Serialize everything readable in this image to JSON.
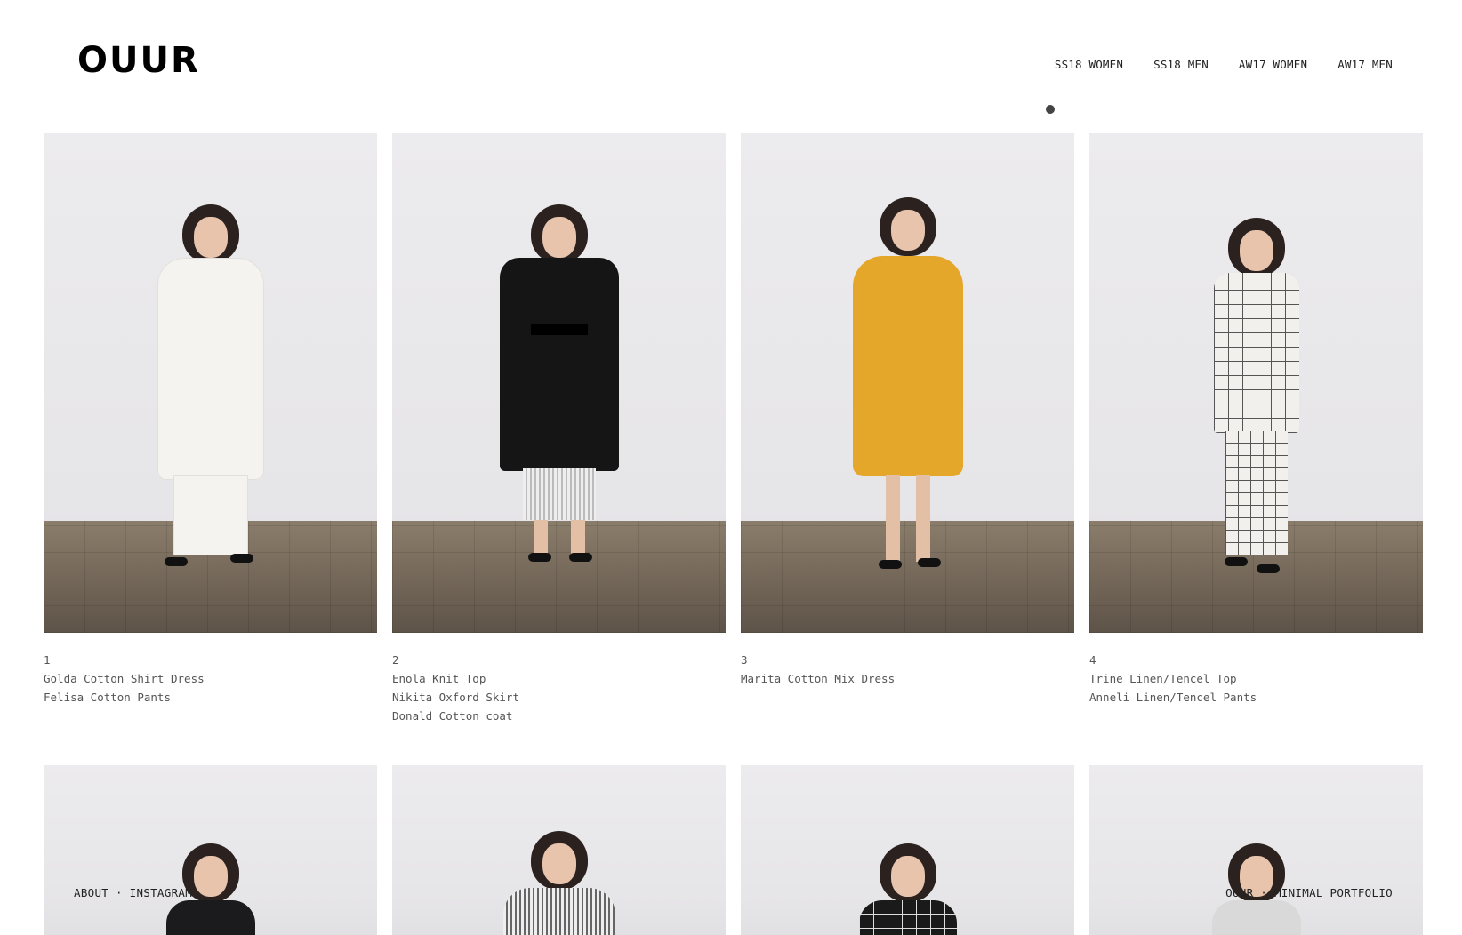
{
  "brand": {
    "logo": "OUUR"
  },
  "nav": {
    "items": [
      "SS18 WOMEN",
      "SS18 MEN",
      "AW17 WOMEN",
      "AW17 MEN"
    ]
  },
  "products": [
    {
      "number": "1",
      "items": [
        "Golda Cotton Shirt Dress",
        "Felisa Cotton Pants"
      ]
    },
    {
      "number": "2",
      "items": [
        "Enola Knit Top",
        "Nikita Oxford Skirt",
        "Donald Cotton coat"
      ]
    },
    {
      "number": "3",
      "items": [
        "Marita Cotton Mix Dress"
      ]
    },
    {
      "number": "4",
      "items": [
        "Trine Linen/Tencel Top",
        "Anneli Linen/Tencel Pants"
      ]
    }
  ],
  "footer": {
    "about": "ABOUT",
    "separator": "·",
    "instagram": "INSTAGRAM",
    "right_text": "OUUR · MINIMAL PORTFOLIO"
  },
  "colors": {
    "outfit_1": "#f4f3f0",
    "outfit_2": "#151515",
    "outfit_3": "#e4a72a",
    "outfit_4": "#f1f0ec",
    "row2_1": "#1b1b1e",
    "row2_2": "#8e8e8e",
    "row2_3": "#1a1a1a",
    "row2_4": "#d9d9d9"
  }
}
